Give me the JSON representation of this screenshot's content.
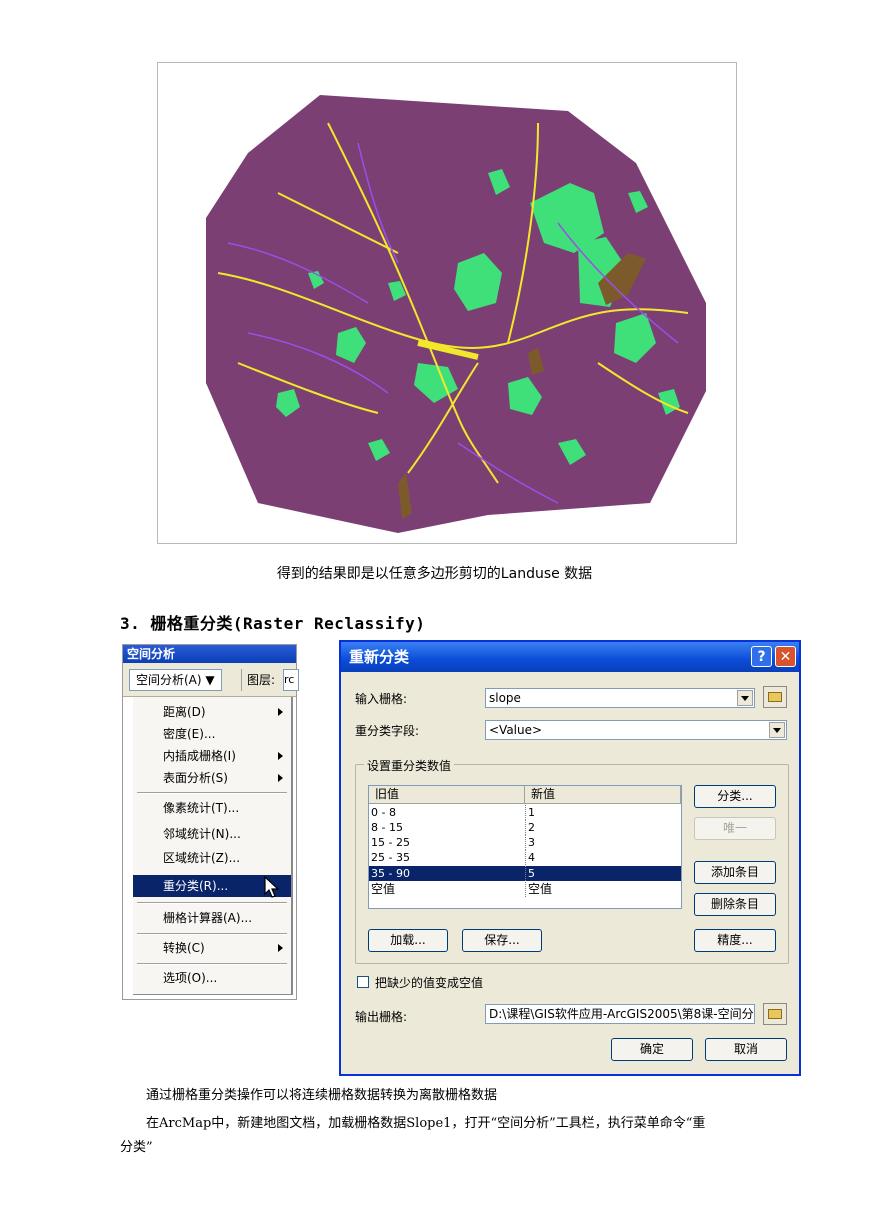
{
  "map": {
    "caption": "得到的结果即是以任意多边形剪切的Landuse 数据",
    "colors": {
      "background": "#7b3f74",
      "landuse": "#3fe07a",
      "roads": "#f2e82a",
      "rivers": "#9b4fe8",
      "brown": "#7d5a2c"
    }
  },
  "section": {
    "heading": "3. 栅格重分类(Raster Reclassify)"
  },
  "spatial_analyst": {
    "title": "空间分析",
    "menu_button": "空间分析(A) ▼",
    "layer_label": "图层:",
    "layer_value": "rc",
    "items": [
      {
        "label": "距离(D)",
        "submenu": true
      },
      {
        "label": "密度(E)...",
        "submenu": false
      },
      {
        "label": "内插成栅格(I)",
        "submenu": true
      },
      {
        "label": "表面分析(S)",
        "submenu": true
      },
      {
        "label": "像素统计(T)...",
        "submenu": false
      },
      {
        "label": "邻域统计(N)...",
        "submenu": false
      },
      {
        "label": "区域统计(Z)...",
        "submenu": false
      },
      {
        "label": "重分类(R)...",
        "submenu": false
      },
      {
        "label": "栅格计算器(A)...",
        "submenu": false
      },
      {
        "label": "转换(C)",
        "submenu": true
      },
      {
        "label": "选项(O)...",
        "submenu": false
      }
    ]
  },
  "reclassify": {
    "title": "重新分类",
    "help_glyph": "?",
    "close_glyph": "✕",
    "input_raster_label": "输入栅格:",
    "input_raster_value": "slope",
    "field_label": "重分类字段:",
    "field_value": "<Value>",
    "group_title": "设置重分类数值",
    "col_old": "旧值",
    "col_new": "新值",
    "rows": [
      {
        "old": "0 - 8",
        "new": "1"
      },
      {
        "old": "8 - 15",
        "new": "2"
      },
      {
        "old": "15 - 25",
        "new": "3"
      },
      {
        "old": "25 - 35",
        "new": "4"
      },
      {
        "old": "35 - 90",
        "new": "5"
      },
      {
        "old": "空值",
        "new": "空值"
      }
    ],
    "btn_classify": "分类...",
    "btn_unique": "唯一",
    "btn_add": "添加条目",
    "btn_delete": "删除条目",
    "btn_load": "加载...",
    "btn_save": "保存...",
    "btn_precision": "精度...",
    "missing_to_nodata": "把缺少的值变成空值",
    "output_raster_label": "输出栅格:",
    "output_raster_value": "D:\\课程\\GIS软件应用-ArcGIS2005\\第8课-空间分",
    "btn_ok": "确定",
    "btn_cancel": "取消"
  },
  "body": {
    "para1": "通过栅格重分类操作可以将连续栅格数据转换为离散栅格数据",
    "para2": "在ArcMap中，新建地图文档，加载栅格数据Slope1，打开“空间分析”工具栏，执行菜单命令“重",
    "para3": "分类”"
  }
}
